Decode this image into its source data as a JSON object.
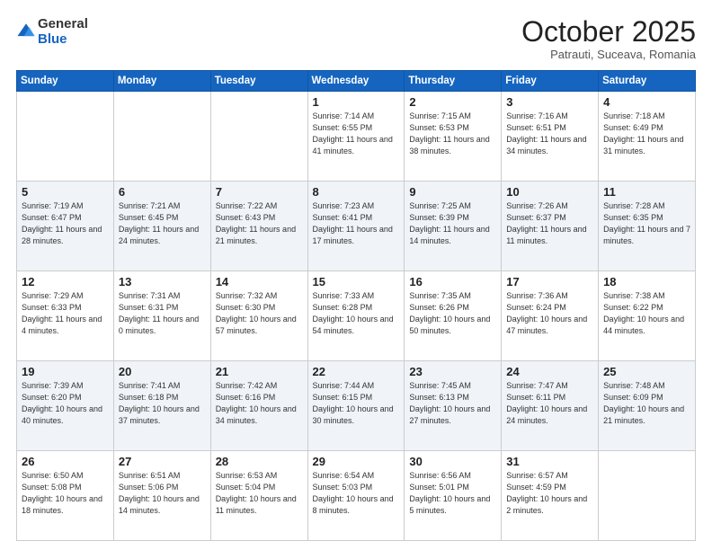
{
  "header": {
    "logo_general": "General",
    "logo_blue": "Blue",
    "month_title": "October 2025",
    "location": "Patrauti, Suceava, Romania"
  },
  "days_of_week": [
    "Sunday",
    "Monday",
    "Tuesday",
    "Wednesday",
    "Thursday",
    "Friday",
    "Saturday"
  ],
  "weeks": [
    [
      {
        "day": "",
        "info": ""
      },
      {
        "day": "",
        "info": ""
      },
      {
        "day": "",
        "info": ""
      },
      {
        "day": "1",
        "info": "Sunrise: 7:14 AM\nSunset: 6:55 PM\nDaylight: 11 hours and 41 minutes."
      },
      {
        "day": "2",
        "info": "Sunrise: 7:15 AM\nSunset: 6:53 PM\nDaylight: 11 hours and 38 minutes."
      },
      {
        "day": "3",
        "info": "Sunrise: 7:16 AM\nSunset: 6:51 PM\nDaylight: 11 hours and 34 minutes."
      },
      {
        "day": "4",
        "info": "Sunrise: 7:18 AM\nSunset: 6:49 PM\nDaylight: 11 hours and 31 minutes."
      }
    ],
    [
      {
        "day": "5",
        "info": "Sunrise: 7:19 AM\nSunset: 6:47 PM\nDaylight: 11 hours and 28 minutes."
      },
      {
        "day": "6",
        "info": "Sunrise: 7:21 AM\nSunset: 6:45 PM\nDaylight: 11 hours and 24 minutes."
      },
      {
        "day": "7",
        "info": "Sunrise: 7:22 AM\nSunset: 6:43 PM\nDaylight: 11 hours and 21 minutes."
      },
      {
        "day": "8",
        "info": "Sunrise: 7:23 AM\nSunset: 6:41 PM\nDaylight: 11 hours and 17 minutes."
      },
      {
        "day": "9",
        "info": "Sunrise: 7:25 AM\nSunset: 6:39 PM\nDaylight: 11 hours and 14 minutes."
      },
      {
        "day": "10",
        "info": "Sunrise: 7:26 AM\nSunset: 6:37 PM\nDaylight: 11 hours and 11 minutes."
      },
      {
        "day": "11",
        "info": "Sunrise: 7:28 AM\nSunset: 6:35 PM\nDaylight: 11 hours and 7 minutes."
      }
    ],
    [
      {
        "day": "12",
        "info": "Sunrise: 7:29 AM\nSunset: 6:33 PM\nDaylight: 11 hours and 4 minutes."
      },
      {
        "day": "13",
        "info": "Sunrise: 7:31 AM\nSunset: 6:31 PM\nDaylight: 11 hours and 0 minutes."
      },
      {
        "day": "14",
        "info": "Sunrise: 7:32 AM\nSunset: 6:30 PM\nDaylight: 10 hours and 57 minutes."
      },
      {
        "day": "15",
        "info": "Sunrise: 7:33 AM\nSunset: 6:28 PM\nDaylight: 10 hours and 54 minutes."
      },
      {
        "day": "16",
        "info": "Sunrise: 7:35 AM\nSunset: 6:26 PM\nDaylight: 10 hours and 50 minutes."
      },
      {
        "day": "17",
        "info": "Sunrise: 7:36 AM\nSunset: 6:24 PM\nDaylight: 10 hours and 47 minutes."
      },
      {
        "day": "18",
        "info": "Sunrise: 7:38 AM\nSunset: 6:22 PM\nDaylight: 10 hours and 44 minutes."
      }
    ],
    [
      {
        "day": "19",
        "info": "Sunrise: 7:39 AM\nSunset: 6:20 PM\nDaylight: 10 hours and 40 minutes."
      },
      {
        "day": "20",
        "info": "Sunrise: 7:41 AM\nSunset: 6:18 PM\nDaylight: 10 hours and 37 minutes."
      },
      {
        "day": "21",
        "info": "Sunrise: 7:42 AM\nSunset: 6:16 PM\nDaylight: 10 hours and 34 minutes."
      },
      {
        "day": "22",
        "info": "Sunrise: 7:44 AM\nSunset: 6:15 PM\nDaylight: 10 hours and 30 minutes."
      },
      {
        "day": "23",
        "info": "Sunrise: 7:45 AM\nSunset: 6:13 PM\nDaylight: 10 hours and 27 minutes."
      },
      {
        "day": "24",
        "info": "Sunrise: 7:47 AM\nSunset: 6:11 PM\nDaylight: 10 hours and 24 minutes."
      },
      {
        "day": "25",
        "info": "Sunrise: 7:48 AM\nSunset: 6:09 PM\nDaylight: 10 hours and 21 minutes."
      }
    ],
    [
      {
        "day": "26",
        "info": "Sunrise: 6:50 AM\nSunset: 5:08 PM\nDaylight: 10 hours and 18 minutes."
      },
      {
        "day": "27",
        "info": "Sunrise: 6:51 AM\nSunset: 5:06 PM\nDaylight: 10 hours and 14 minutes."
      },
      {
        "day": "28",
        "info": "Sunrise: 6:53 AM\nSunset: 5:04 PM\nDaylight: 10 hours and 11 minutes."
      },
      {
        "day": "29",
        "info": "Sunrise: 6:54 AM\nSunset: 5:03 PM\nDaylight: 10 hours and 8 minutes."
      },
      {
        "day": "30",
        "info": "Sunrise: 6:56 AM\nSunset: 5:01 PM\nDaylight: 10 hours and 5 minutes."
      },
      {
        "day": "31",
        "info": "Sunrise: 6:57 AM\nSunset: 4:59 PM\nDaylight: 10 hours and 2 minutes."
      },
      {
        "day": "",
        "info": ""
      }
    ]
  ]
}
